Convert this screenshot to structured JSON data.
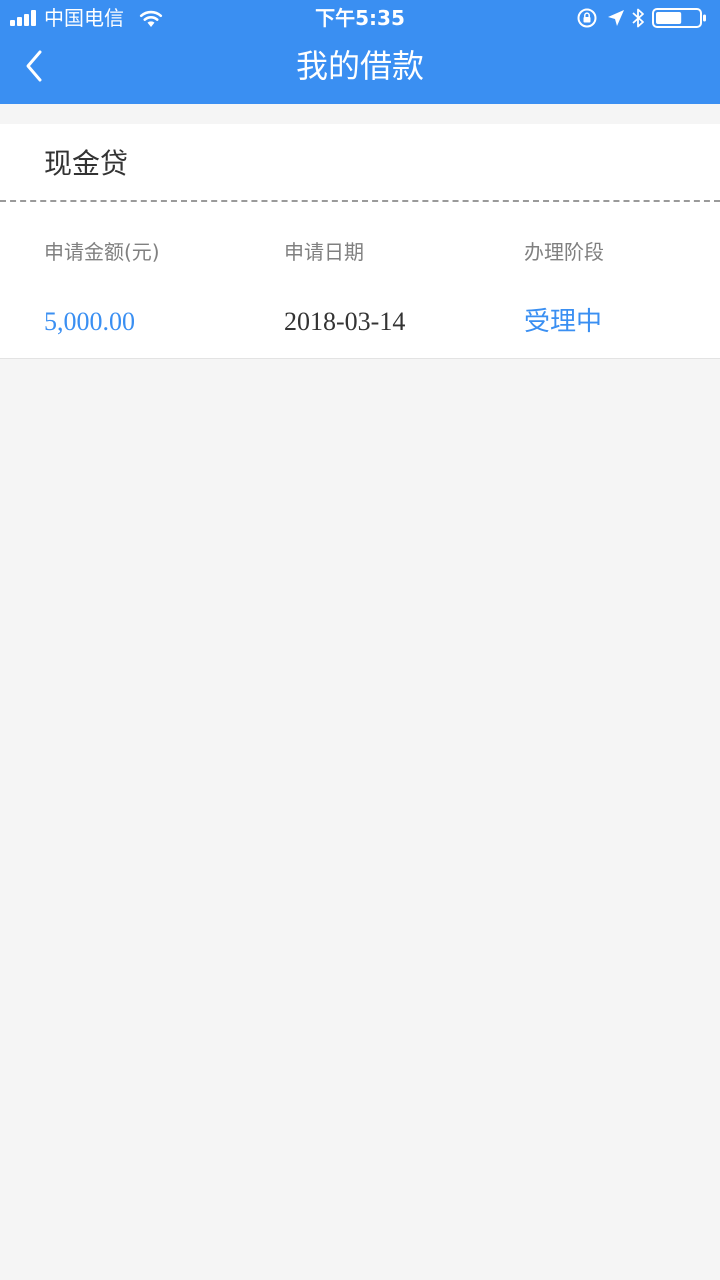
{
  "status_bar": {
    "carrier": "中国电信",
    "time": "下午5:35",
    "battery_level": 0.6
  },
  "nav": {
    "title": "我的借款"
  },
  "loan_card": {
    "product": "现金贷",
    "columns": [
      {
        "label": "申请金额(元)",
        "value": "5,000.00"
      },
      {
        "label": "申请日期",
        "value": "2018-03-14"
      },
      {
        "label": "办理阶段",
        "value": "受理中"
      }
    ]
  },
  "colors": {
    "primary": "#3a8ff2",
    "background": "#f5f5f5",
    "text_dark": "#333333",
    "text_muted": "#808080"
  }
}
